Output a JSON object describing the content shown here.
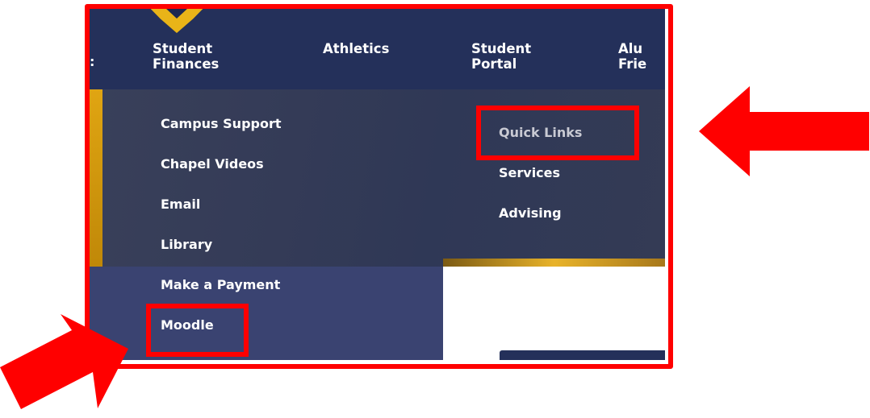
{
  "nav": {
    "cut_text": ":",
    "items": [
      {
        "label": "Student\nFinances"
      },
      {
        "label": "Athletics"
      },
      {
        "label": "Student\nPortal"
      },
      {
        "label": "Alu\nFrie"
      }
    ]
  },
  "dropdown": {
    "left_links": [
      {
        "label": "Campus Support"
      },
      {
        "label": "Chapel Videos"
      },
      {
        "label": "Email"
      },
      {
        "label": "Library"
      },
      {
        "label": "Make a Payment"
      },
      {
        "label": "Moodle"
      }
    ],
    "right_links": [
      {
        "label": "Quick Links"
      },
      {
        "label": "Services"
      },
      {
        "label": "Advising"
      }
    ]
  },
  "colors": {
    "nav_bg": "#24305a",
    "dropdown_bg": "#343b57",
    "lower_panel_bg": "#3a4371",
    "gold": "#e9b418",
    "annotation_red": "#ff0000"
  }
}
